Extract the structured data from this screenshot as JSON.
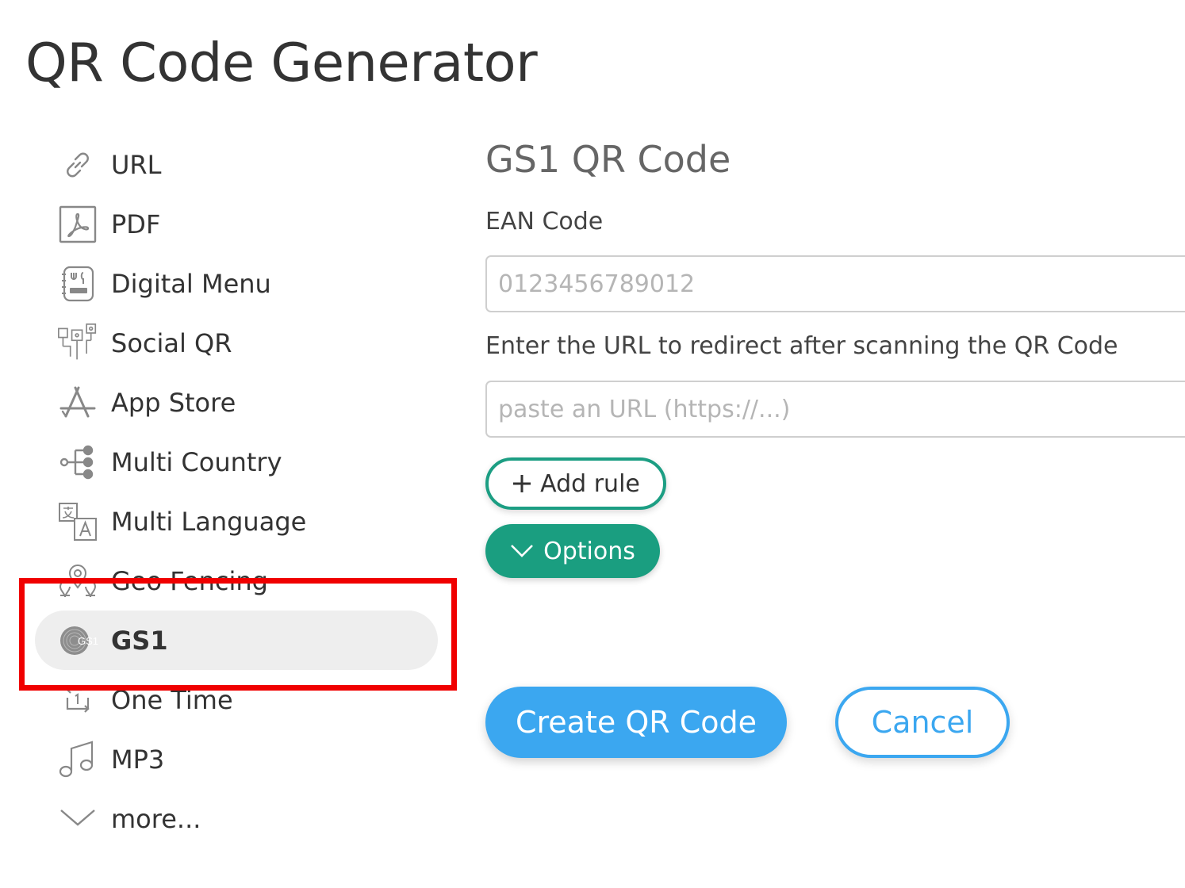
{
  "page": {
    "title": "QR Code Generator"
  },
  "sidebar": {
    "items": [
      {
        "label": "URL",
        "icon": "link-icon"
      },
      {
        "label": "PDF",
        "icon": "pdf-icon"
      },
      {
        "label": "Digital Menu",
        "icon": "menu-icon"
      },
      {
        "label": "Social QR",
        "icon": "social-icon"
      },
      {
        "label": "App Store",
        "icon": "app-store-icon"
      },
      {
        "label": "Multi Country",
        "icon": "multi-country-icon"
      },
      {
        "label": "Multi Language",
        "icon": "translate-icon"
      },
      {
        "label": "Geo Fencing",
        "icon": "geo-pin-icon"
      },
      {
        "label": "GS1",
        "icon": "gs1-icon",
        "active": true
      },
      {
        "label": "One Time",
        "icon": "one-time-icon"
      },
      {
        "label": "MP3",
        "icon": "music-note-icon"
      },
      {
        "label": "more...",
        "icon": "chevron-down-icon"
      }
    ],
    "icon_glyphs": {
      "gs1": "GS1"
    }
  },
  "form": {
    "title": "GS1 QR Code",
    "ean_label": "EAN Code",
    "ean_placeholder": "0123456789012",
    "url_label": "Enter the URL to redirect after scanning the QR Code",
    "url_placeholder": "paste an URL (https://...)",
    "add_rule_label": "Add rule",
    "options_label": "Options",
    "create_label": "Create QR Code",
    "cancel_label": "Cancel"
  },
  "colors": {
    "highlight": "#f00000",
    "accent_green": "#1a9e80",
    "accent_blue": "#3ba7f0",
    "active_bg": "#eeeeee"
  }
}
